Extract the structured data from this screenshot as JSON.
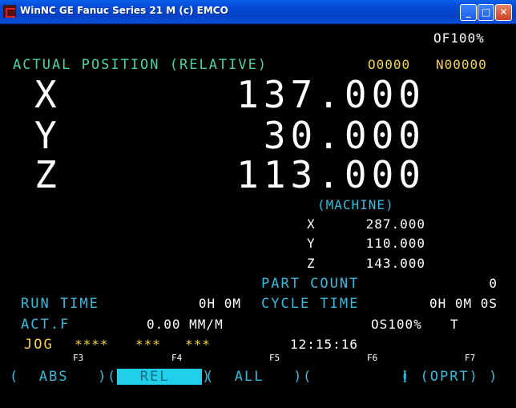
{
  "window": {
    "title": "WinNC GE Fanuc Series 21 M (c) EMCO",
    "minimize": "_",
    "maximize": "□",
    "close": "✕"
  },
  "status": {
    "override": "OF100%"
  },
  "header": {
    "title": "ACTUAL POSITION (RELATIVE)",
    "program": "O0000",
    "sequence": "N00000"
  },
  "relative": {
    "x_label": "X",
    "x_value": "137.000",
    "y_label": "Y",
    "y_value": "30.000",
    "z_label": "Z",
    "z_value": "113.000"
  },
  "machine": {
    "title": "(MACHINE)",
    "x_label": "X",
    "x_value": "287.000",
    "y_label": "Y",
    "y_value": "110.000",
    "z_label": "Z",
    "z_value": "143.000"
  },
  "info": {
    "part_count_label": "PART COUNT",
    "part_count_value": "0",
    "run_time_label": "RUN TIME",
    "run_time_value": "0H 0M",
    "cycle_time_label": "CYCLE TIME",
    "cycle_time_value": "0H 0M 0S",
    "actf_label": "ACT.F",
    "actf_value": "0.00 MM/M",
    "spindle_override": "OS100%",
    "tool": "T"
  },
  "statusline": {
    "mode": "JOG",
    "stars1": "****",
    "stars2": "***",
    "stars3": "***",
    "clock": "12:15:16"
  },
  "softkeys": {
    "f3": "F3",
    "f4": "F4",
    "f5": "F5",
    "f6": "F6",
    "f7": "F7",
    "abs": "ABS",
    "rel": "REL",
    "all": "ALL",
    "oprt": "(OPRT)"
  },
  "colors": {
    "background": "#000000",
    "label_green": "#4ad3a3",
    "label_cyan": "#3cb8dc",
    "warning_yellow": "#f4d24a",
    "active_softkey": "#1fd0e8",
    "titlebar_blue": "#0548d4"
  }
}
